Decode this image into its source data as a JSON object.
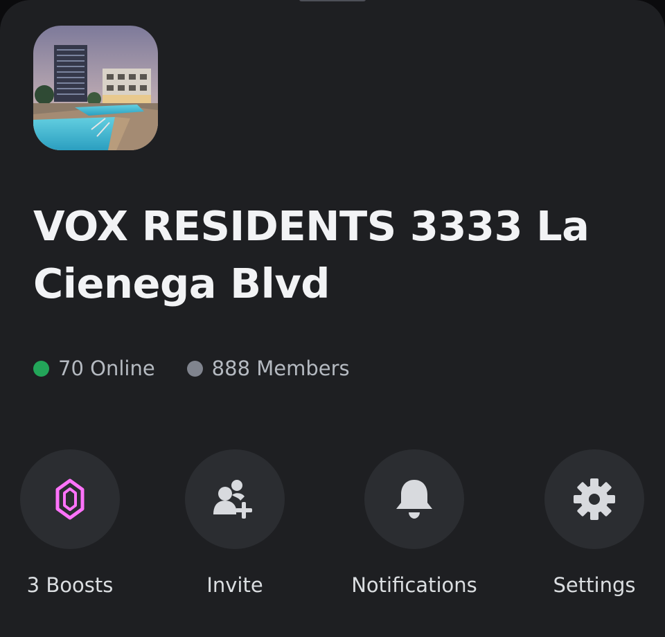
{
  "server": {
    "name": "VOX RESIDENTS 3333 La Cienega Blvd",
    "icon": "server-avatar-photo-pool-buildings"
  },
  "stats": {
    "online_label": "70 Online",
    "members_label": "888 Members",
    "online_color": "#23a559",
    "members_color": "#80848e"
  },
  "actions": [
    {
      "label": "3 Boosts",
      "icon": "boost-gem-icon",
      "color": "#ff73fa"
    },
    {
      "label": "Invite",
      "icon": "add-friend-icon",
      "color": "#d8dade"
    },
    {
      "label": "Notifications",
      "icon": "bell-icon",
      "color": "#d8dade"
    },
    {
      "label": "Settings",
      "icon": "gear-icon",
      "color": "#d8dade"
    }
  ]
}
